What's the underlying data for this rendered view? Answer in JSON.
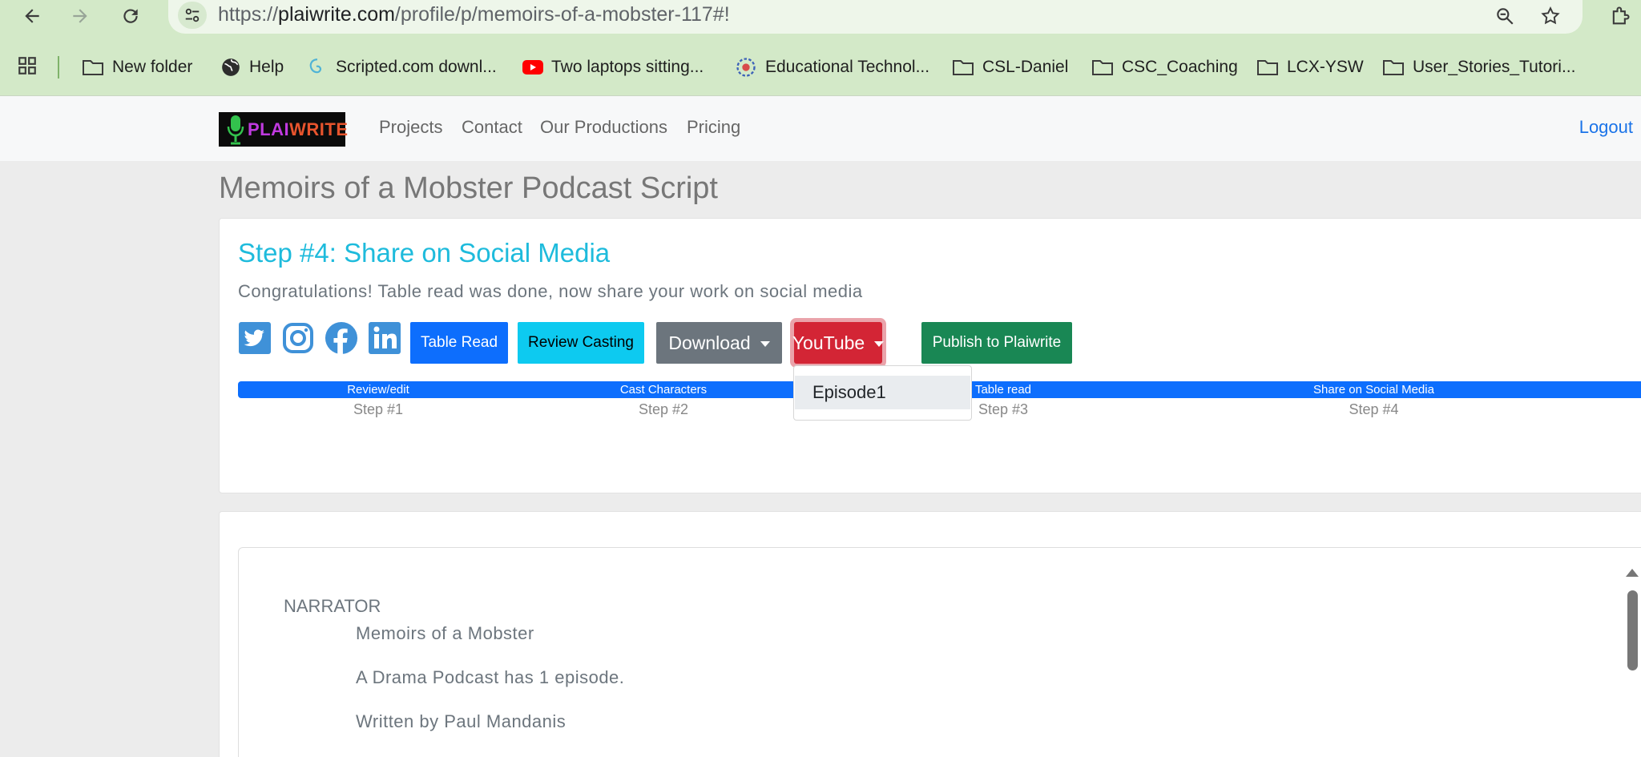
{
  "browser": {
    "url_prefix": "https://",
    "url_domain": "plaiwrite.com",
    "url_path": "/profile/p/memoirs-of-a-mobster-117#!",
    "bookmarks": [
      {
        "label": "New folder",
        "icon": "folder-icon"
      },
      {
        "label": "Help",
        "icon": "globe-icon"
      },
      {
        "label": "Scripted.com downl...",
        "icon": "scripted-icon"
      },
      {
        "label": "Two laptops sitting...",
        "icon": "youtube-icon"
      },
      {
        "label": "Educational Technol...",
        "icon": "edtech-icon"
      },
      {
        "label": "CSL-Daniel",
        "icon": "folder-icon"
      },
      {
        "label": "CSC_Coaching",
        "icon": "folder-icon"
      },
      {
        "label": "LCX-YSW",
        "icon": "folder-icon"
      },
      {
        "label": "User_Stories_Tutori...",
        "icon": "folder-icon"
      }
    ]
  },
  "site_nav": {
    "logo_part1": "PLAI",
    "logo_part2": "WRITE",
    "links": [
      "Projects",
      "Contact",
      "Our Productions",
      "Pricing"
    ],
    "logout": "Logout"
  },
  "page": {
    "title": "Memoirs of a Mobster Podcast Script"
  },
  "share_card": {
    "step_title": "Step #4: Share on Social Media",
    "subtitle": "Congratulations! Table read was done, now share your work on social media",
    "social_icons": [
      "twitter-icon",
      "instagram-icon",
      "facebook-icon",
      "linkedin-icon"
    ],
    "buttons": {
      "table_read": "Table Read",
      "review_casting": "Review Casting",
      "download": "Download",
      "youtube": "YouTube",
      "publish": "Publish to Plaiwrite"
    },
    "youtube_menu": [
      "Episode1"
    ],
    "progress_percent": 100,
    "steps": [
      {
        "label": "Review/edit",
        "number": "Step #1"
      },
      {
        "label": "Cast Characters",
        "number": "Step #2"
      },
      {
        "label": "Table read",
        "number": "Step #3"
      },
      {
        "label": "Share on Social Media",
        "number": "Step #4"
      }
    ],
    "colors": {
      "title": "#1ebbdc",
      "primary": "#0d6efd",
      "info": "#0dcaf0",
      "secondary": "#6c757d",
      "danger": "#d32535",
      "success": "#198754"
    }
  },
  "script": {
    "speaker": "NARRATOR",
    "lines": [
      "Memoirs of a Mobster",
      "A Drama Podcast has 1 episode.",
      "Written by Paul Mandanis"
    ]
  }
}
